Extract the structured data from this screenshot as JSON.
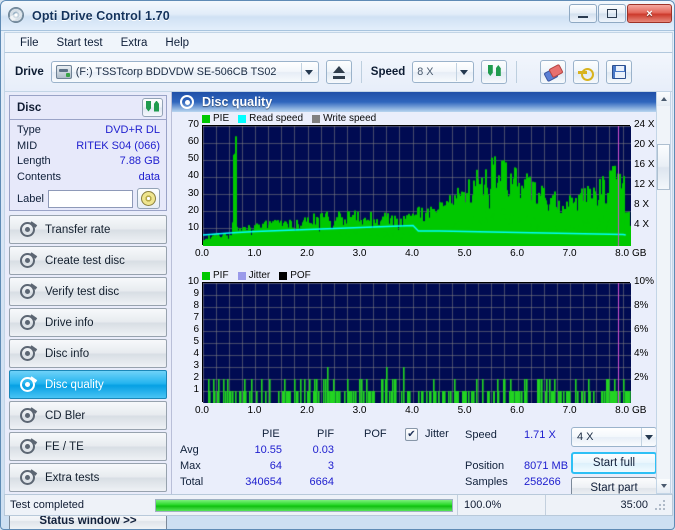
{
  "window": {
    "title": "Opti Drive Control 1.70",
    "icon": "disc-icon",
    "minimize": "minimize-icon",
    "maximize": "maximize-icon",
    "close": "×"
  },
  "menu": {
    "items": [
      "File",
      "Start test",
      "Extra",
      "Help"
    ]
  },
  "toolbar": {
    "drive_label": "Drive",
    "drive_value": "(F:)  TSSTcorp BDDVDW SE-506CB TS02",
    "eject_icon": "eject-icon",
    "speed_label": "Speed",
    "speed_value": "8 X",
    "refresh_icon": "refresh-icon",
    "eraser_icon": "eraser-icon",
    "key_icon": "key-icon",
    "save_icon": "save-icon"
  },
  "disc_panel": {
    "title": "Disc",
    "refresh_icon": "refresh-icon",
    "rows": [
      {
        "label": "Type",
        "value": "DVD+R DL"
      },
      {
        "label": "MID",
        "value": "RITEK S04 (066)"
      },
      {
        "label": "Length",
        "value": "7.88 GB"
      },
      {
        "label": "Contents",
        "value": "data"
      }
    ],
    "label_row": {
      "label": "Label",
      "value": "",
      "disc_icon": "cd-icon"
    }
  },
  "nav": {
    "items": [
      {
        "label": "Transfer rate",
        "active": false
      },
      {
        "label": "Create test disc",
        "active": false
      },
      {
        "label": "Verify test disc",
        "active": false
      },
      {
        "label": "Drive info",
        "active": false
      },
      {
        "label": "Disc info",
        "active": false
      },
      {
        "label": "Disc quality",
        "active": true
      },
      {
        "label": "CD Bler",
        "active": false
      },
      {
        "label": "FE / TE",
        "active": false
      },
      {
        "label": "Extra tests",
        "active": false
      }
    ],
    "status_window_button": "Status window >>"
  },
  "content": {
    "header": "Disc quality",
    "header_icon": "disc-quality-icon"
  },
  "stats": {
    "col_headers": [
      "PIE",
      "PIF",
      "POF"
    ],
    "row_labels": [
      "Avg",
      "Max",
      "Total"
    ],
    "pie": {
      "avg": "10.55",
      "max": "64",
      "total": "340654"
    },
    "pif": {
      "avg": "0.03",
      "max": "3",
      "total": "6664"
    },
    "pof": {
      "avg": "",
      "max": "",
      "total": ""
    },
    "jitter_label": "Jitter",
    "jitter_checked": true,
    "speed_label": "Speed",
    "speed_value": "1.71 X",
    "position_label": "Position",
    "position_value": "8071 MB",
    "samples_label": "Samples",
    "samples_value": "258266",
    "speed_select_value": "4 X",
    "start_full_button": "Start full",
    "start_part_button": "Start part"
  },
  "statusbar": {
    "text": "Test completed",
    "progress_percent": "100.0%",
    "progress_value": 100,
    "elapsed": "35:00"
  },
  "chart_data": [
    {
      "type": "area",
      "name": "disc-quality-pie-chart",
      "title": "",
      "xlabel": "GB",
      "ylabel": "",
      "xlim": [
        0,
        8.15
      ],
      "ylim": [
        0,
        70
      ],
      "y2lim": [
        0,
        24
      ],
      "y2label": "X",
      "xticks": [
        "0.0",
        "1.0",
        "2.0",
        "3.0",
        "4.0",
        "5.0",
        "6.0",
        "7.0",
        "8.0"
      ],
      "xtick_values": [
        0,
        1,
        2,
        3,
        4,
        5,
        6,
        7,
        8
      ],
      "xunit": "GB",
      "yticks": [
        "10",
        "20",
        "30",
        "40",
        "50",
        "60",
        "70"
      ],
      "ytick_values": [
        10,
        20,
        30,
        40,
        50,
        60,
        70
      ],
      "y2ticks": [
        "4 X",
        "8 X",
        "12 X",
        "16 X",
        "20 X",
        "24 X"
      ],
      "y2tick_values": [
        4,
        8,
        12,
        16,
        20,
        24
      ],
      "grid": true,
      "bg": "#000b52",
      "legend": [
        {
          "label": "PIE",
          "color": "#00c800"
        },
        {
          "label": "Read speed",
          "color": "#00ffff"
        },
        {
          "label": "Write speed",
          "color": "#808080"
        }
      ],
      "series": [
        {
          "name": "PIE",
          "color": "#00c800",
          "kind": "area",
          "axis": "left",
          "x": [
            0.0,
            0.05,
            0.1,
            0.15,
            0.2,
            0.25,
            0.3,
            0.35,
            0.4,
            0.45,
            0.5,
            0.55,
            0.6,
            0.62,
            0.65,
            0.7,
            0.75,
            0.8,
            0.85,
            0.9,
            0.95,
            1.0,
            1.1,
            1.2,
            1.3,
            1.4,
            1.5,
            1.6,
            1.7,
            1.8,
            1.9,
            2.0,
            2.1,
            2.2,
            2.3,
            2.4,
            2.5,
            2.6,
            2.7,
            2.8,
            2.9,
            3.0,
            3.1,
            3.2,
            3.3,
            3.4,
            3.5,
            3.6,
            3.7,
            3.8,
            3.9,
            4.0,
            4.1,
            4.2,
            4.3,
            4.4,
            4.5,
            4.6,
            4.7,
            4.8,
            4.9,
            5.0,
            5.1,
            5.2,
            5.3,
            5.4,
            5.5,
            5.6,
            5.7,
            5.8,
            5.9,
            6.0,
            6.1,
            6.2,
            6.3,
            6.4,
            6.5,
            6.6,
            6.7,
            6.8,
            6.9,
            7.0,
            7.1,
            7.2,
            7.3,
            7.4,
            7.5,
            7.6,
            7.7,
            7.8,
            7.9,
            8.0,
            8.05
          ],
          "y": [
            3,
            4,
            5,
            4,
            6,
            5,
            7,
            5,
            6,
            5,
            6,
            5,
            64,
            40,
            8,
            9,
            10,
            9,
            11,
            10,
            9,
            11,
            10,
            12,
            11,
            13,
            12,
            11,
            13,
            12,
            14,
            13,
            15,
            14,
            16,
            15,
            14,
            16,
            15,
            17,
            16,
            15,
            14,
            16,
            15,
            14,
            16,
            15,
            13,
            14,
            15,
            16,
            18,
            17,
            19,
            18,
            20,
            22,
            24,
            26,
            28,
            30,
            32,
            34,
            36,
            38,
            40,
            41,
            42,
            40,
            38,
            36,
            34,
            32,
            30,
            28,
            27,
            26,
            25,
            24,
            23,
            24,
            25,
            26,
            27,
            28,
            30,
            32,
            34,
            36,
            38,
            42,
            16
          ]
        },
        {
          "name": "Read speed",
          "color": "#00ffff",
          "kind": "line",
          "axis": "right",
          "x": [
            0.0,
            0.5,
            1.0,
            1.5,
            2.0,
            2.5,
            3.0,
            3.5,
            4.0,
            4.1,
            4.5,
            5.0,
            5.5,
            6.0,
            6.5,
            7.0,
            7.5,
            8.0,
            8.05
          ],
          "y": [
            2.2,
            2.6,
            2.9,
            3.1,
            3.3,
            3.5,
            3.7,
            3.9,
            4.1,
            3.0,
            3.0,
            2.9,
            2.8,
            2.7,
            2.6,
            2.5,
            2.4,
            2.3,
            2.2
          ]
        }
      ]
    },
    {
      "type": "bar",
      "name": "disc-quality-pif-chart",
      "title": "",
      "xlabel": "GB",
      "ylabel": "",
      "xlim": [
        0,
        8.15
      ],
      "ylim": [
        0,
        10
      ],
      "y2lim": [
        0,
        10
      ],
      "y2label": "%",
      "xticks": [
        "0.0",
        "1.0",
        "2.0",
        "3.0",
        "4.0",
        "5.0",
        "6.0",
        "7.0",
        "8.0"
      ],
      "xtick_values": [
        0,
        1,
        2,
        3,
        4,
        5,
        6,
        7,
        8
      ],
      "xunit": "GB",
      "yticks": [
        "1",
        "2",
        "3",
        "4",
        "5",
        "6",
        "7",
        "8",
        "9",
        "10"
      ],
      "ytick_values": [
        1,
        2,
        3,
        4,
        5,
        6,
        7,
        8,
        9,
        10
      ],
      "y2ticks": [
        "2%",
        "4%",
        "6%",
        "8%",
        "10%"
      ],
      "y2tick_values": [
        2,
        4,
        6,
        8,
        10
      ],
      "grid": true,
      "bg": "#000b52",
      "legend": [
        {
          "label": "PIF",
          "color": "#00c800"
        },
        {
          "label": "Jitter",
          "color": "#9a9aea"
        },
        {
          "label": "POF",
          "color": "#000000"
        }
      ],
      "series": [
        {
          "name": "PIF",
          "color": "#22d422",
          "kind": "spikes",
          "axis": "left",
          "x": [
            0.07,
            0.12,
            0.2,
            0.28,
            0.33,
            0.42,
            0.55,
            0.58,
            0.62,
            0.72,
            0.85,
            0.95,
            1.05,
            1.1,
            1.25,
            1.4,
            1.52,
            1.6,
            1.72,
            1.85,
            1.95,
            2.02,
            2.12,
            2.2,
            2.25,
            2.3,
            2.38,
            2.45,
            2.55,
            2.62,
            2.7,
            2.8,
            2.9,
            3.0,
            3.08,
            3.2,
            3.3,
            3.38,
            3.5,
            3.6,
            3.7,
            3.78,
            3.85,
            3.92,
            4.0,
            4.05,
            4.12,
            4.2,
            4.3,
            4.4,
            4.5,
            4.6,
            4.7,
            4.8,
            4.9,
            5.0,
            5.1,
            5.2,
            5.3,
            5.4,
            5.5,
            5.6,
            5.7,
            5.8,
            5.9,
            6.0,
            6.1,
            6.2,
            6.3,
            6.4,
            6.5,
            6.6,
            6.7,
            6.8,
            6.9,
            7.0,
            7.1,
            7.2,
            7.3,
            7.4,
            7.5,
            7.6,
            7.7,
            7.8,
            7.9,
            8.0
          ],
          "y": [
            1,
            1,
            1,
            2,
            1,
            1,
            1,
            1,
            1,
            1,
            1,
            1,
            1,
            1,
            1,
            1,
            1,
            1,
            1,
            2,
            1,
            1,
            2,
            1,
            1,
            2,
            1,
            1,
            1,
            1,
            1,
            1,
            1,
            1,
            1,
            1,
            1,
            2,
            1,
            2,
            1,
            3,
            2,
            1,
            2,
            1,
            1,
            1,
            1,
            1,
            1,
            1,
            1,
            1,
            1,
            1,
            1,
            2,
            1,
            1,
            1,
            1,
            2,
            1,
            1,
            1,
            2,
            1,
            1,
            2,
            1,
            1,
            2,
            1,
            1,
            2,
            1,
            1,
            2,
            1,
            1,
            1,
            2,
            1,
            1,
            1
          ]
        }
      ]
    }
  ]
}
